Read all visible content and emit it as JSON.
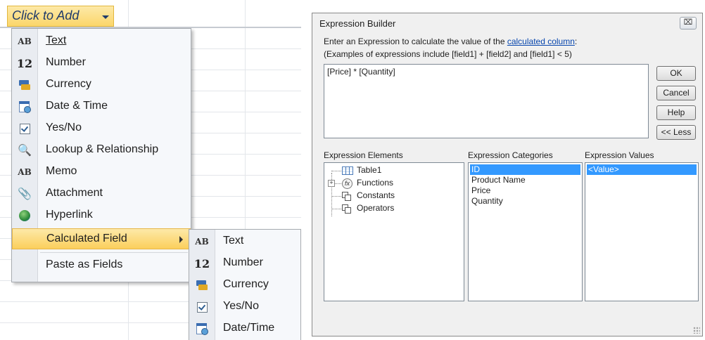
{
  "left": {
    "header": {
      "click_to_add": "Click to Add"
    },
    "menu": [
      {
        "label": "Text",
        "icon": "ab-text-icon",
        "glyph": "AB"
      },
      {
        "label": "Number",
        "icon": "number-12-icon",
        "glyph": "12"
      },
      {
        "label": "Currency",
        "icon": "currency-icon"
      },
      {
        "label": "Date & Time",
        "icon": "calendar-clock-icon"
      },
      {
        "label": "Yes/No",
        "icon": "checkbox-icon"
      },
      {
        "label": "Lookup & Relationship",
        "icon": "lookup-relationship-icon"
      },
      {
        "label": "Memo",
        "icon": "ab-memo-icon",
        "glyph": "AB"
      },
      {
        "label": "Attachment",
        "icon": "paperclip-icon"
      },
      {
        "label": "Hyperlink",
        "icon": "hyperlink-globe-icon"
      },
      {
        "label": "Calculated Field",
        "icon": "",
        "highlighted": true
      },
      {
        "label": "Paste as Fields",
        "icon": ""
      }
    ],
    "submenu": [
      {
        "label": "Text",
        "icon": "ab-text-icon",
        "glyph": "AB"
      },
      {
        "label": "Number",
        "icon": "number-12-icon",
        "glyph": "12"
      },
      {
        "label": "Currency",
        "icon": "currency-icon"
      },
      {
        "label": "Yes/No",
        "icon": "checkbox-icon"
      },
      {
        "label": "Date/Time",
        "icon": "calendar-clock-icon"
      }
    ],
    "colors": {
      "highlight": "#fbd66a",
      "header_text": "#1f3a6a"
    }
  },
  "dialog": {
    "title": "Expression Builder",
    "close_glyph": "⌧",
    "instruction_prefix": "Enter an Expression to calculate the value of the",
    "instruction_link": "calculated column",
    "instruction_suffix": ":",
    "examples": "(Examples of expressions include [field1] + [field2] and [field1] < 5)",
    "expression": "[Price] * [Quantity]",
    "buttons": {
      "ok": "OK",
      "cancel": "Cancel",
      "help": "Help",
      "less": "<< Less"
    },
    "headers": {
      "elements": "Expression Elements",
      "categories": "Expression Categories",
      "values": "Expression Values"
    },
    "elements": [
      {
        "label": "Table1",
        "icon": "table-icon"
      },
      {
        "label": "Functions",
        "icon": "function-fx-icon",
        "expandable": true
      },
      {
        "label": "Constants",
        "icon": "constants-icon"
      },
      {
        "label": "Operators",
        "icon": "operators-icon"
      }
    ],
    "categories": [
      "ID",
      "Product Name",
      "Price",
      "Quantity"
    ],
    "values": [
      "<Value>"
    ],
    "colors": {
      "selection": "#3399ff",
      "link": "#0645ad"
    }
  }
}
